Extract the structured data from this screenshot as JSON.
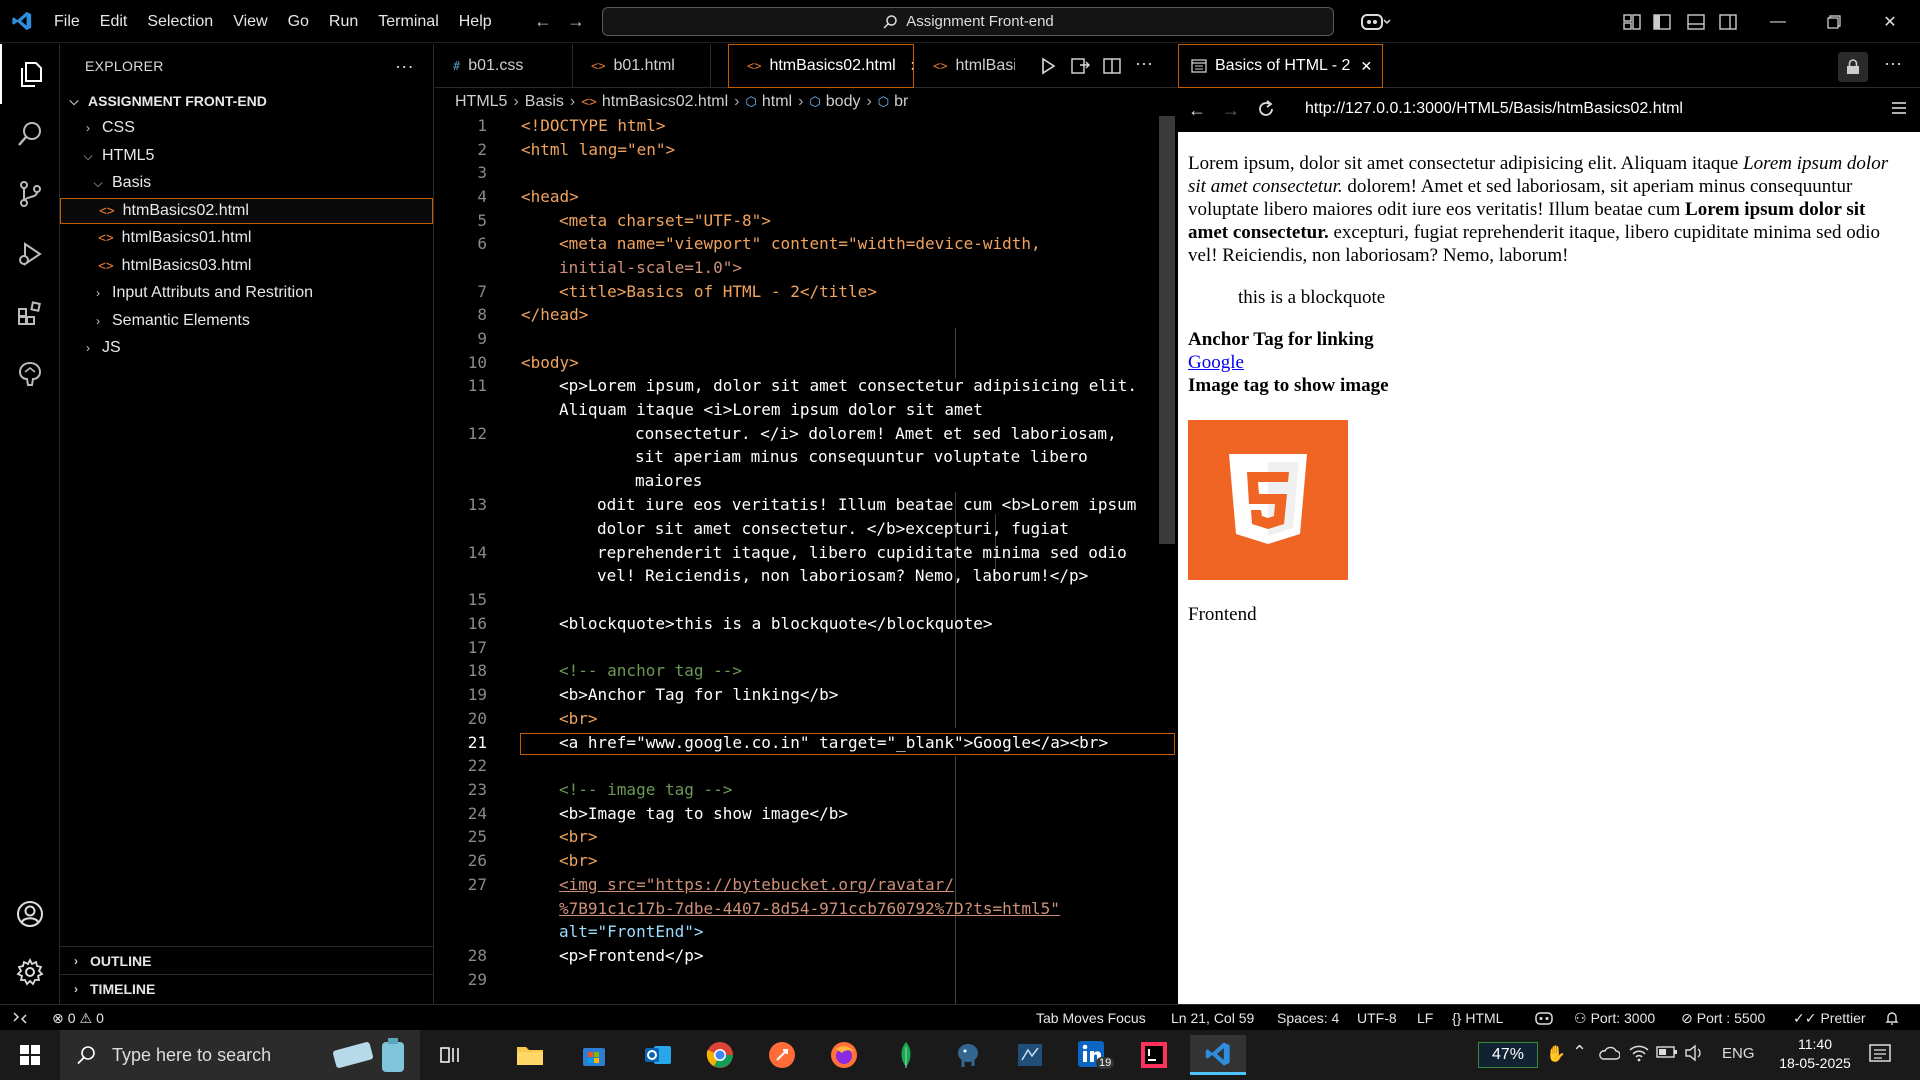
{
  "titlebar": {
    "menu": [
      "File",
      "Edit",
      "Selection",
      "View",
      "Go",
      "Run",
      "Terminal",
      "Help"
    ],
    "search_label": "Assignment Front-end"
  },
  "explorer": {
    "title": "EXPLORER",
    "more": "···",
    "root": "ASSIGNMENT FRONT-END",
    "items": [
      {
        "label": "CSS",
        "type": "folder",
        "expanded": false
      },
      {
        "label": "HTML5",
        "type": "folder",
        "expanded": true
      },
      {
        "label": "Basis",
        "type": "folder",
        "expanded": true
      },
      {
        "label": "htmBasics02.html",
        "type": "file",
        "selected": true
      },
      {
        "label": "htmlBasics01.html",
        "type": "file"
      },
      {
        "label": "htmlBasics03.html",
        "type": "file"
      },
      {
        "label": "Input Attributs and Restrition",
        "type": "folder",
        "expanded": false
      },
      {
        "label": "Semantic Elements",
        "type": "folder",
        "expanded": false
      },
      {
        "label": "JS",
        "type": "folder",
        "expanded": false
      }
    ],
    "outline": "OUTLINE",
    "timeline": "TIMELINE"
  },
  "tabs": [
    {
      "label": "b01.css",
      "icon": "#",
      "active": false
    },
    {
      "label": "b01.html",
      "icon": "<>",
      "active": false
    },
    {
      "label": "htmBasics02.html",
      "icon": "<>",
      "active": true
    },
    {
      "label": "htmlBasic",
      "icon": "<>",
      "active": false
    }
  ],
  "breadcrumb": [
    "HTML5",
    "Basis",
    "htmBasics02.html",
    "html",
    "body",
    "br"
  ],
  "code_lines": {
    "l1": "<!DOCTYPE html>",
    "l2": "<html lang=\"en\">",
    "l4": "<head>",
    "l5": "<meta charset=\"UTF-8\">",
    "l6a": "<meta name=\"viewport\" content=\"width=device-width,",
    "l6b": "initial-scale=1.0\">",
    "l7": "<title>Basics of HTML - 2</title>",
    "l8": "</head>",
    "l10": "<body>",
    "l11a": "<p>Lorem ipsum, dolor sit amet consectetur adipisicing elit.",
    "l11b": "Aliquam itaque <i>Lorem ipsum dolor sit amet",
    "l12a": "consectetur. </i> dolorem! Amet et sed laboriosam,",
    "l12b": "sit aperiam minus consequuntur voluptate libero",
    "l12c": "maiores",
    "l13a": "odit iure eos veritatis! Illum beatae cum <b>Lorem ipsum",
    "l13b": "dolor sit amet consectetur. </b>excepturi, fugiat",
    "l14a": "reprehenderit itaque, libero cupiditate minima sed odio",
    "l14b": "vel! Reiciendis, non laboriosam? Nemo, laborum!</p>",
    "l16": "<blockquote>this is a blockquote</blockquote>",
    "l18": "<!-- anchor tag -->",
    "l19": "<b>Anchor Tag for linking</b>",
    "l20": "<br>",
    "l21": "<a href=\"www.google.co.in\" target=\"_blank\">Google</a><br>",
    "l23": "<!-- image tag -->",
    "l24": "<b>Image tag to show image</b>",
    "l25": "<br>",
    "l26": "<br>",
    "l27a": "<img src=\"https://bytebucket.org/ravatar/",
    "l27b": "%7B91c1c17b-7dbe-4407-8d54-971ccb760792%7D?ts=html5\"",
    "l27c": "alt=\"FrontEnd\">",
    "l28": "<p>Frontend</p>"
  },
  "preview": {
    "tab_title": "Basics of HTML - 2",
    "url": "http://127.0.0.1:3000/HTML5/Basis/htmBasics02.html",
    "p1_a": "Lorem ipsum, dolor sit amet consectetur adipisicing elit. Aliquam itaque ",
    "p1_i": "Lorem ipsum dolor sit amet consectetur.",
    "p1_b_pre": " dolorem! Amet et sed laboriosam, sit aperiam minus consequuntur voluptate libero maiores odit iure eos veritatis! Illum beatae cum ",
    "p1_bold": "Lorem ipsum dolor sit amet consectetur.",
    "p1_end": " excepturi, fugiat reprehenderit itaque, libero cupiditate minima sed odio vel! Reiciendis, non laboriosam? Nemo, laborum!",
    "blockquote": "this is a blockquote",
    "anchor_heading": "Anchor Tag for linking",
    "link": "Google",
    "image_heading": "Image tag to show image",
    "image_digit": "5",
    "footer_p": "Frontend"
  },
  "statusbar": {
    "errors": "0",
    "warnings": "0",
    "tab_moves": "Tab Moves Focus",
    "position": "Ln 21, Col 59",
    "spaces": "Spaces: 4",
    "encoding": "UTF-8",
    "eol": "LF",
    "language": "HTML",
    "port1": "Port: 3000",
    "port2": "Port : 5500",
    "prettier": "Prettier"
  },
  "taskbar": {
    "search_placeholder": "Type here to search",
    "battery": "47%",
    "lang": "ENG",
    "time": "11:40",
    "date": "18-05-2025",
    "linkedin_badge": "19"
  },
  "colors": {
    "accent": "#c25e00",
    "html5_orange": "#f16524",
    "vscode_blue": "#0078d4"
  }
}
